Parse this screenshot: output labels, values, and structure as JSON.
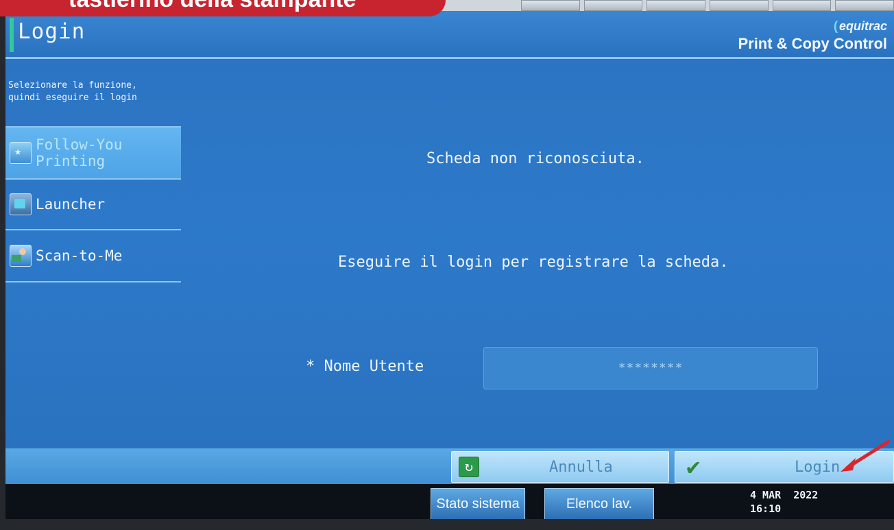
{
  "banner": {
    "text": "tastierino della stampante"
  },
  "header": {
    "title": "Login",
    "brand_name": "equitrac",
    "brand_product": "Print & Copy Control"
  },
  "sidebar": {
    "hint_line1": "Selezionare la funzione,",
    "hint_line2": "quindi eseguire il login",
    "items": [
      {
        "label_line1": "Follow-You",
        "label_line2": "Printing",
        "icon": "follow-you-printing-icon",
        "active": true
      },
      {
        "label": "Launcher",
        "icon": "launcher-icon"
      },
      {
        "label": "Scan-to-Me",
        "icon": "scan-to-me-icon"
      }
    ]
  },
  "main": {
    "message_card": "Scheda non riconosciuta.",
    "message_login": "Eseguire il login per registrare la scheda.",
    "username_label": "* Nome Utente",
    "username_value": "********"
  },
  "actions": {
    "cancel_label": "Annulla",
    "login_label": "Login"
  },
  "status_bar": {
    "system_status_label": "Stato sistema",
    "job_list_label": "Elenco lav.",
    "date": "4 MAR  2022",
    "time": "16:10"
  },
  "colors": {
    "screen_blue": "#2b73c1",
    "banner_red": "#c8242f",
    "button_light": "#bfe5fb",
    "arrow_red": "#d8272c"
  }
}
